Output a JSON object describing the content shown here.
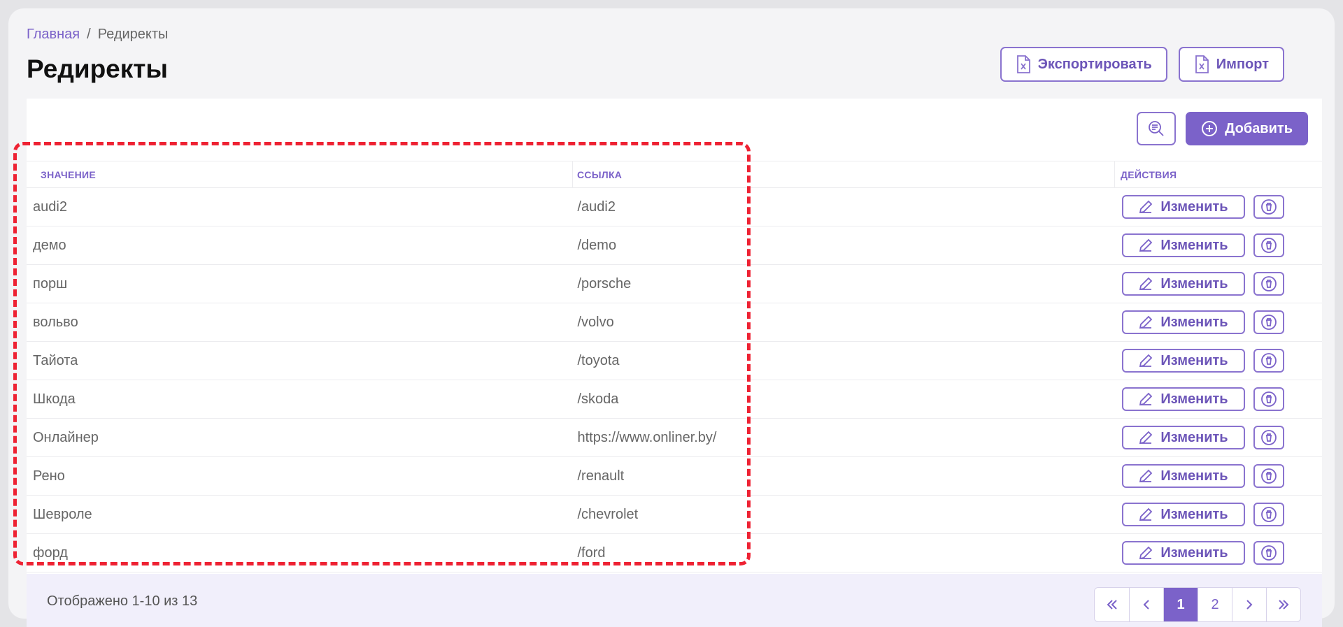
{
  "breadcrumb": {
    "home": "Главная",
    "separator": "/",
    "current": "Редиректы"
  },
  "page": {
    "title": "Редиректы"
  },
  "header_actions": {
    "export_label": "Экспортировать",
    "import_label": "Импорт"
  },
  "toolbar": {
    "filter_icon": "search-list-icon",
    "add_label": "Добавить"
  },
  "table": {
    "headers": {
      "value": "ЗНАЧЕНИЕ",
      "link": "ССЫЛКА",
      "actions": "ДЕЙСТВИЯ"
    },
    "edit_label": "Изменить",
    "rows": [
      {
        "value": "audi2",
        "link": "/audi2"
      },
      {
        "value": "демо",
        "link": "/demo"
      },
      {
        "value": "порш",
        "link": "/porsche"
      },
      {
        "value": "вольво",
        "link": "/volvo"
      },
      {
        "value": "Тайота",
        "link": "/toyota"
      },
      {
        "value": "Шкода",
        "link": "/skoda"
      },
      {
        "value": "Онлайнер",
        "link": "https://www.onliner.by/"
      },
      {
        "value": "Рено",
        "link": "/renault"
      },
      {
        "value": "Шевроле",
        "link": "/chevrolet"
      },
      {
        "value": "форд",
        "link": "/ford"
      }
    ]
  },
  "footer": {
    "summary": "Отображено 1-10 из 13",
    "pages": [
      "1",
      "2"
    ],
    "current_page": "1"
  },
  "colors": {
    "accent": "#7b62c9",
    "highlight": "#ee2233"
  }
}
